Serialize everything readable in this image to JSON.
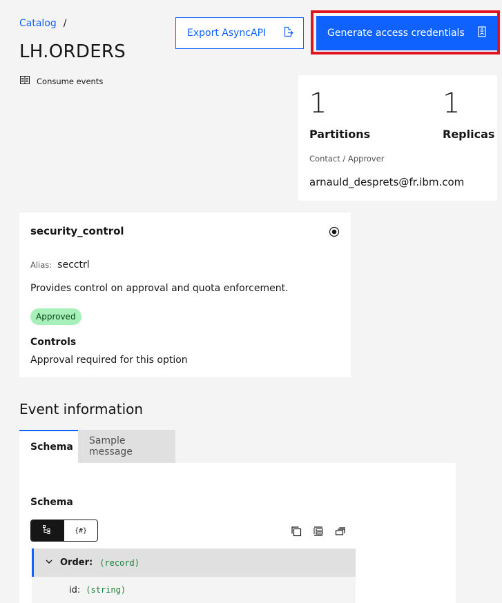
{
  "breadcrumb": {
    "catalog": "Catalog",
    "separator": "/"
  },
  "page_title": "LH.ORDERS",
  "consume_link": "Consume events",
  "actions": {
    "export_label": "Export AsyncAPI",
    "generate_label": "Generate access credentials"
  },
  "stats": {
    "partitions_value": "1",
    "partitions_label": "Partitions",
    "replicas_value": "1",
    "replicas_label": "Replicas",
    "contact_label": "Contact / Approver",
    "contact_value": "arnauld_desprets@fr.ibm.com"
  },
  "security": {
    "title": "security_control",
    "alias_key": "Alias:",
    "alias_value": "secctrl",
    "description": "Provides control on approval and quota enforcement.",
    "status": "Approved",
    "controls_heading": "Controls",
    "controls_value": "Approval required for this option"
  },
  "event_info": {
    "heading": "Event information",
    "tabs": [
      "Schema",
      "Sample message"
    ],
    "schema_heading": "Schema",
    "view_toggle": [
      "tree-view-icon",
      "{#}"
    ],
    "tree": [
      {
        "name": "Order:",
        "type": "(record)"
      },
      {
        "name": "id:",
        "type": "(string)"
      }
    ]
  },
  "colors": {
    "accent": "#0f62fe",
    "highlight": "#e0141e",
    "approved_bg": "#a7f0ba"
  }
}
